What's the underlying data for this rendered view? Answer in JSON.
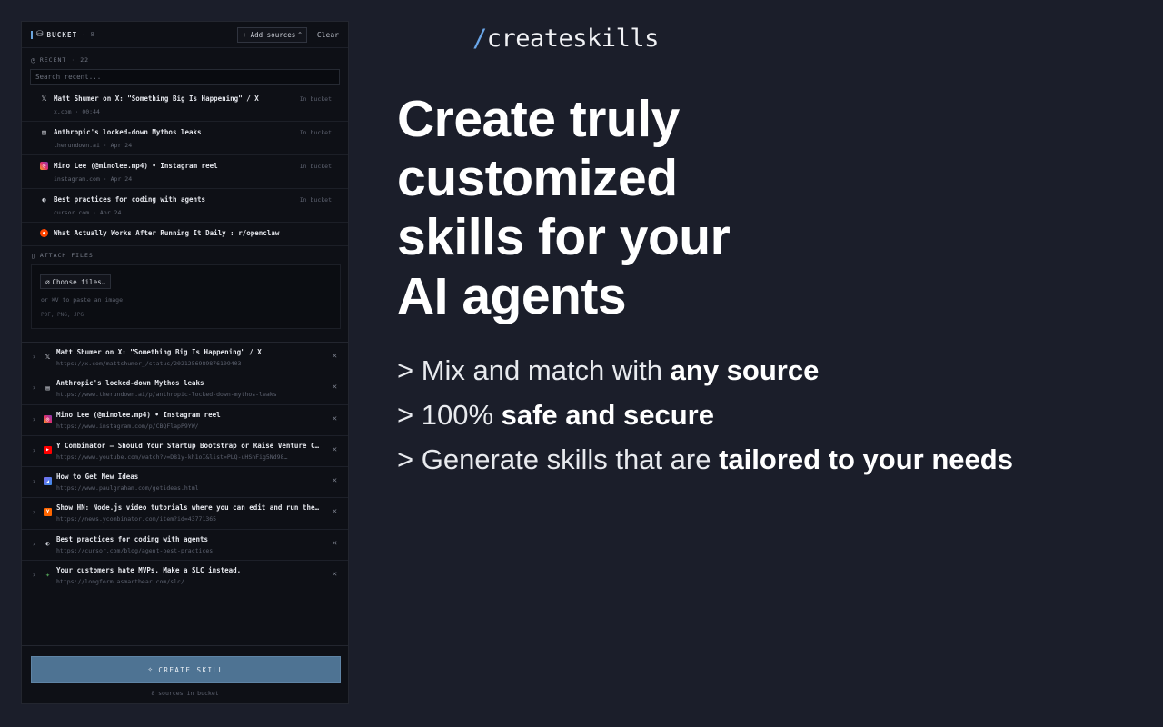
{
  "panel": {
    "header": {
      "title": "BUCKET",
      "count": "8",
      "add_sources_label": "+ Add sources",
      "clear_label": "Clear"
    },
    "recent": {
      "label": "RECENT",
      "count": "22",
      "search_placeholder": "Search recent...",
      "items": [
        {
          "icon": "x-icon",
          "title": "Matt Shumer on X: \"Something Big Is Happening\" / X",
          "domain": "x.com",
          "date": "00:44",
          "badge": "In bucket"
        },
        {
          "icon": "newspaper-icon",
          "title": "Anthropic's locked-down Mythos leaks",
          "domain": "therundown.ai",
          "date": "Apr 24",
          "badge": "In bucket"
        },
        {
          "icon": "instagram-icon",
          "title": "Mino Lee (@minolee.mp4) • Instagram reel",
          "domain": "instagram.com",
          "date": "Apr 24",
          "badge": "In bucket"
        },
        {
          "icon": "cursor-icon",
          "title": "Best practices for coding with agents",
          "domain": "cursor.com",
          "date": "Apr 24",
          "badge": "In bucket"
        },
        {
          "icon": "reddit-icon",
          "title": "What Actually Works After Running It Daily : r/openclaw",
          "domain": "",
          "date": "",
          "badge": ""
        }
      ]
    },
    "attach": {
      "label": "ATTACH FILES",
      "choose_label": "Choose files…",
      "hint": "or ⌘V to paste an image",
      "types": "PDF, PNG, JPG"
    },
    "bucket_items": [
      {
        "icon": "x-icon",
        "title": "Matt Shumer on X: \"Something Big Is Happening\" / X",
        "url": "https://x.com/mattshumer_/status/2021256989876109403"
      },
      {
        "icon": "newspaper-icon",
        "title": "Anthropic's locked-down Mythos leaks",
        "url": "https://www.therundown.ai/p/anthropic-locked-down-mythos-leaks"
      },
      {
        "icon": "instagram-icon",
        "title": "Mino Lee (@minolee.mp4) • Instagram reel",
        "url": "https://www.instagram.com/p/CBQFlapP9YW/"
      },
      {
        "icon": "youtube-icon",
        "title": "Y Combinator – Should Your Startup Bootstrap or Raise Venture Capital?",
        "url": "https://www.youtube.com/watch?v=D81y-kh1oI&list=PLQ-uHSnFig5Nd98…"
      },
      {
        "icon": "paulgraham-icon",
        "title": "How to Get New Ideas",
        "url": "https://www.paulgraham.com/getideas.html"
      },
      {
        "icon": "ycombinator-icon",
        "title": "Show HN: Node.js video tutorials where you can edit and run the code",
        "url": "https://news.ycombinator.com/item?id=43771365"
      },
      {
        "icon": "cursor-icon",
        "title": "Best practices for coding with agents",
        "url": "https://cursor.com/blog/agent-best-practices"
      },
      {
        "icon": "smartbear-icon",
        "title": "Your customers hate MVPs. Make a SLC instead.",
        "url": "https://longform.asmartbear.com/slc/"
      }
    ],
    "footer": {
      "create_label": "CREATE SKILL",
      "note": "8 sources in bucket"
    }
  },
  "hero": {
    "brand_slash": "/",
    "brand_name": "createskills",
    "headline": [
      "Create truly",
      "customized",
      "skills for your",
      "AI agents"
    ],
    "bullets": [
      {
        "prefix": "> Mix and match with ",
        "bold": "any source"
      },
      {
        "prefix": "> 100% ",
        "bold": "safe and secure"
      },
      {
        "prefix": "> Generate skills that are ",
        "bold": "tailored to your needs"
      }
    ]
  },
  "colors": {
    "background": "#1b1e2a",
    "panel": "#0e1016",
    "accent": "#6aa6e8",
    "create_button": "#4e7393"
  }
}
